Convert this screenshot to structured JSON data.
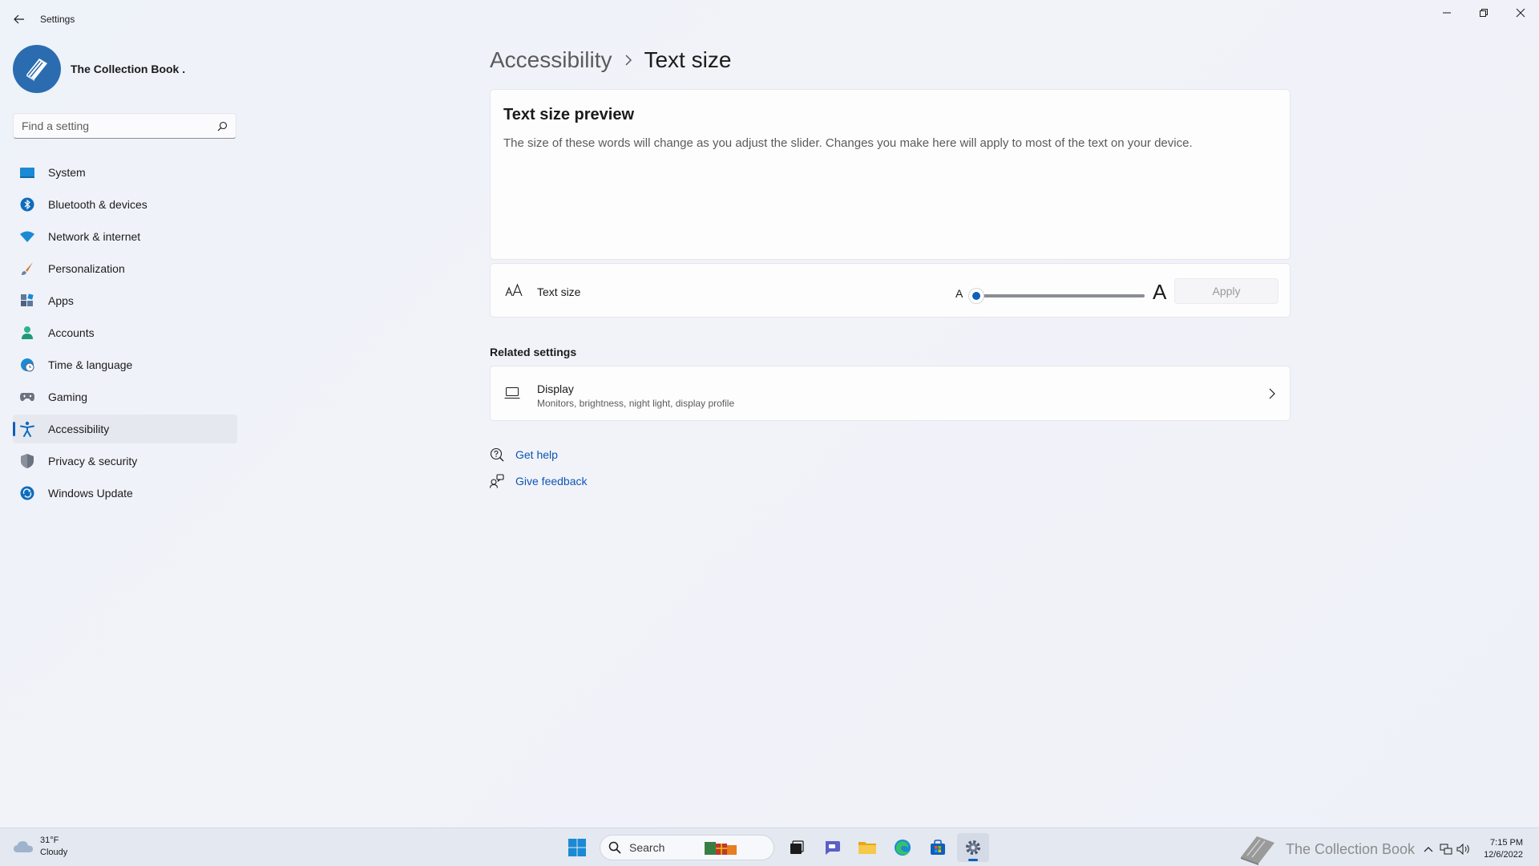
{
  "window": {
    "title": "Settings",
    "controls": [
      "minimize-icon",
      "restore-icon",
      "close-icon"
    ]
  },
  "profile": {
    "name": "The Collection Book ."
  },
  "search": {
    "placeholder": "Find a setting"
  },
  "sidebar": {
    "items": [
      {
        "label": "System",
        "icon": "system-icon",
        "color": "#1a8ad4"
      },
      {
        "label": "Bluetooth & devices",
        "icon": "bluetooth-icon",
        "color": "#0f6cbd"
      },
      {
        "label": "Network & internet",
        "icon": "wifi-icon",
        "color": "#1a8ad4"
      },
      {
        "label": "Personalization",
        "icon": "brush-icon",
        "color": "#d47a3b"
      },
      {
        "label": "Apps",
        "icon": "apps-icon",
        "color": "#4a6382"
      },
      {
        "label": "Accounts",
        "icon": "accounts-icon",
        "color": "#2bb48a"
      },
      {
        "label": "Time & language",
        "icon": "globe-clock-icon",
        "color": "#1a8ad4"
      },
      {
        "label": "Gaming",
        "icon": "gamepad-icon",
        "color": "#6b7280"
      },
      {
        "label": "Accessibility",
        "icon": "accessibility-icon",
        "color": "#0f6cbd",
        "selected": true
      },
      {
        "label": "Privacy & security",
        "icon": "shield-icon",
        "color": "#6b7280"
      },
      {
        "label": "Windows Update",
        "icon": "update-icon",
        "color": "#0f6cbd"
      }
    ]
  },
  "breadcrumb": {
    "parent": "Accessibility",
    "current": "Text size"
  },
  "preview": {
    "title": "Text size preview",
    "text": "The size of these words will change as you adjust the slider. Changes you make here will apply to most of the text on your device."
  },
  "text_size": {
    "label": "Text size",
    "small_glyph": "A",
    "large_glyph": "A",
    "value_fraction": 0.0,
    "apply_label": "Apply",
    "apply_enabled": false
  },
  "related": {
    "title": "Related settings",
    "display": {
      "label": "Display",
      "description": "Monitors, brightness, night light, display profile"
    }
  },
  "help": {
    "get_help": "Get help",
    "give_feedback": "Give feedback"
  },
  "taskbar": {
    "weather_temp": "31°F",
    "weather_desc": "Cloudy",
    "search_label": "Search",
    "watermark": "The Collection Book",
    "time": "7:15 PM",
    "date": "12/6/2022"
  },
  "colors": {
    "accent": "#0f5fbd",
    "link": "#0b56b3",
    "background": "#eef1f7"
  }
}
